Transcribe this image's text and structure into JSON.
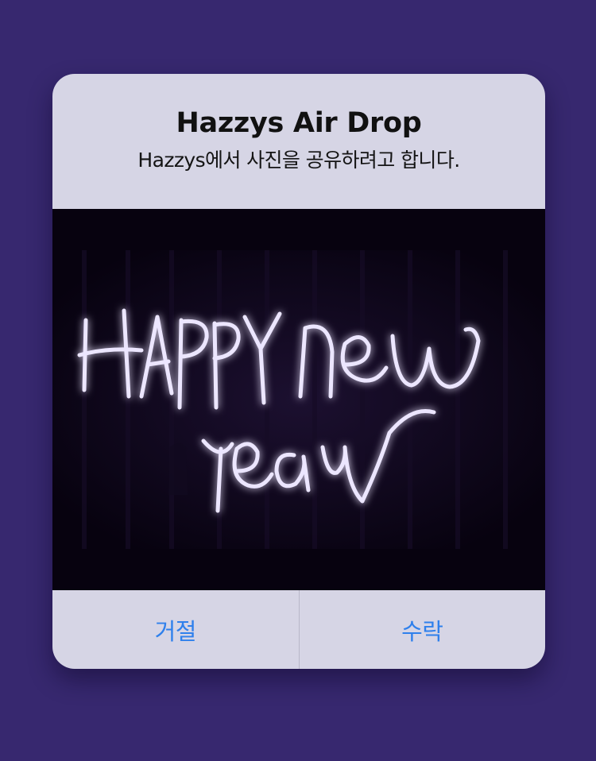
{
  "dialog": {
    "title": "Hazzys Air Drop",
    "message": "Hazzys에서 사진을 공유하려고 합니다.",
    "decline_label": "거절",
    "accept_label": "수락"
  },
  "photo": {
    "text_line1": "Happy new",
    "text_line2": "year"
  },
  "colors": {
    "background": "#37286f",
    "dialog": "#d6d5e5",
    "button_text": "#2f80ec",
    "light_trail": "#e8e2ff"
  }
}
